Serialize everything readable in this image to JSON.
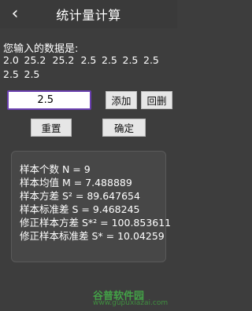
{
  "header": {
    "back_icon": "chevron-left-icon",
    "title": "统计量计算"
  },
  "input_section": {
    "prompt": "您输入的数据是:",
    "values": [
      "2.0",
      "25.2",
      "25.2",
      "2.5",
      "2.5",
      "2.5",
      "2.5",
      "2.5",
      "2.5"
    ],
    "current_value": "2.5"
  },
  "buttons": {
    "add": "添加",
    "delete": "回删",
    "reset": "重置",
    "confirm": "确定"
  },
  "results": {
    "count": "样本个数 N = 9",
    "mean": "样本均值 M = 7.488889",
    "variance": "样本方差 S² = 89.647654",
    "stddev": "样本标准差 S = 9.468245",
    "corrected_variance": "修正样本方差 S*² = 100.853611",
    "corrected_stddev": "修正样本标准差 S* = 10.04259"
  },
  "watermark": {
    "brand": "谷普软件园",
    "url": "www.gupuxiazai.com"
  }
}
